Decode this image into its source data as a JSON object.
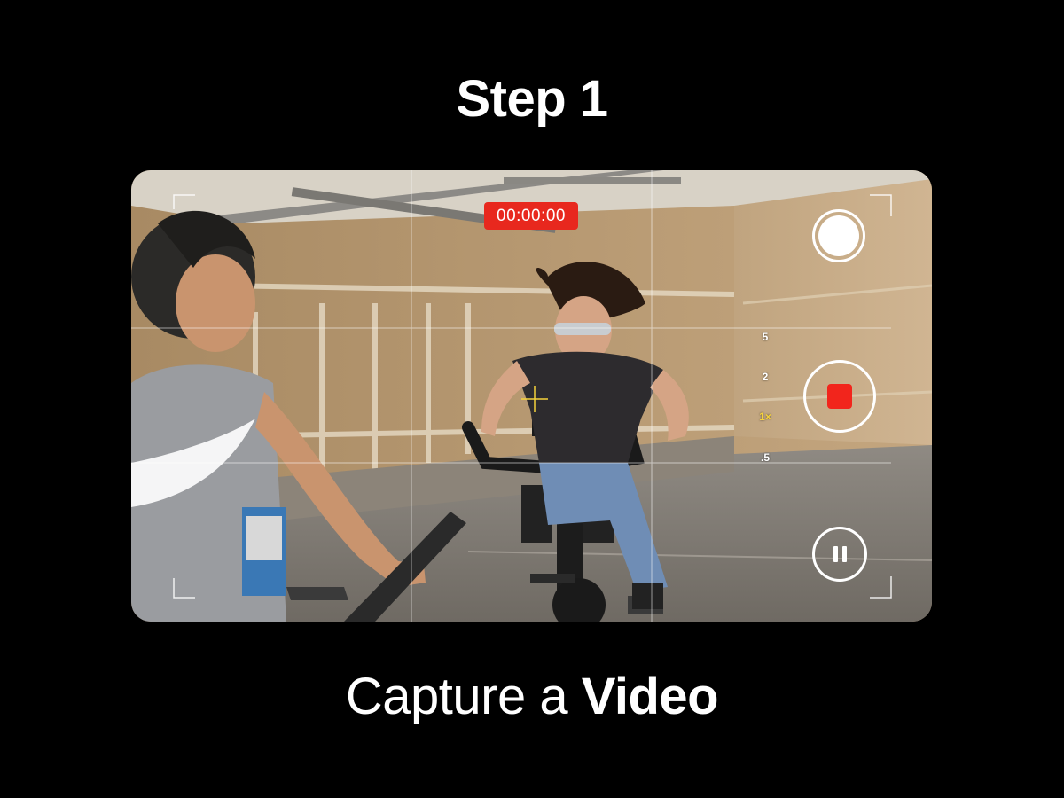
{
  "header": {
    "title": "Step 1"
  },
  "caption": {
    "prefix": "Capture a ",
    "emphasis": "Video"
  },
  "camera": {
    "timer": "00:00:00",
    "zoom_levels": [
      "5",
      "2",
      "1×",
      ".5"
    ],
    "active_zoom": "1×",
    "colors": {
      "record": "#f2251c",
      "timer_bg": "#e8281e",
      "active_zoom": "#f5d23b"
    }
  },
  "icons": [
    "shutter-icon",
    "stop-icon",
    "pause-icon",
    "focus-crosshair-icon"
  ]
}
